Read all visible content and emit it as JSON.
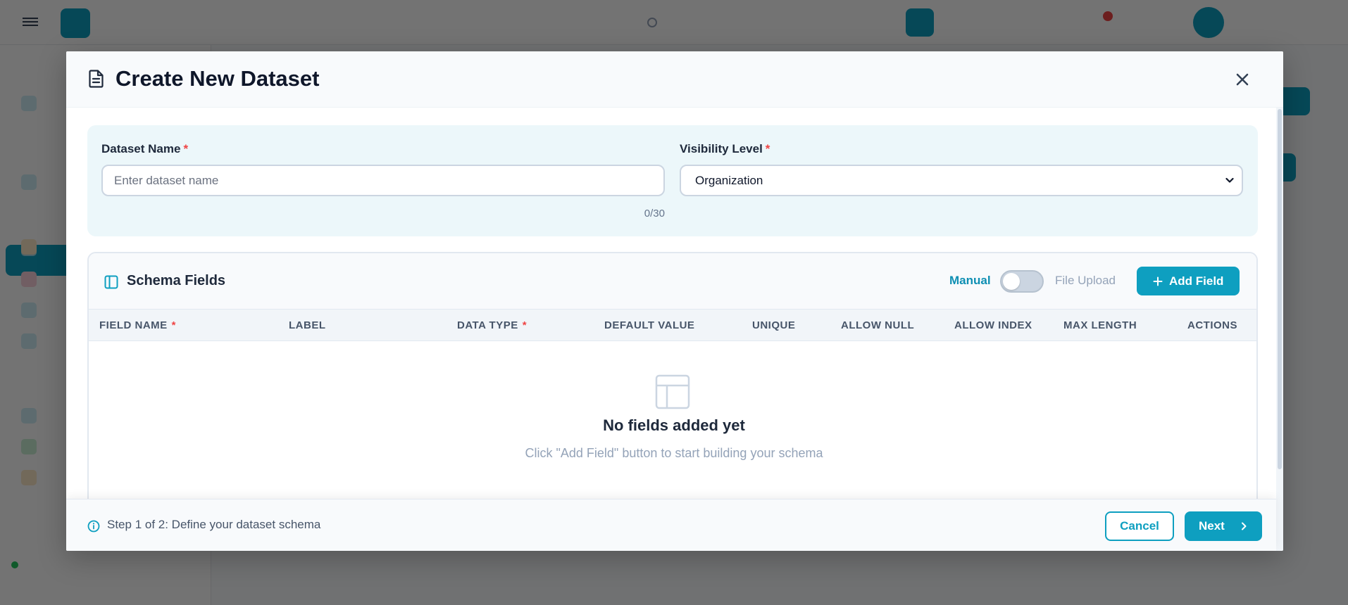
{
  "modal": {
    "title": "Create New Dataset",
    "dataset_name": {
      "label": "Dataset Name",
      "required_mark": "*",
      "value": "",
      "placeholder": "Enter dataset name",
      "counter": "0/30"
    },
    "visibility": {
      "label": "Visibility Level",
      "required_mark": "*",
      "selected": "Organization"
    },
    "schema": {
      "title": "Schema Fields",
      "mode_manual": "Manual",
      "mode_file": "File Upload",
      "add_field_label": "Add Field",
      "columns": [
        "FIELD NAME",
        "LABEL",
        "DATA TYPE",
        "DEFAULT VALUE",
        "UNIQUE",
        "ALLOW NULL",
        "ALLOW INDEX",
        "MAX LENGTH",
        "ACTIONS"
      ],
      "required_mark": "*",
      "empty_title": "No fields added yet",
      "empty_subtitle": "Click \"Add Field\" button to start building your schema"
    },
    "footer": {
      "step_text": "Step 1 of 2: Define your dataset schema",
      "cancel_label": "Cancel",
      "next_label": "Next"
    }
  },
  "colors": {
    "accent": "#0e9fc0",
    "required": "#ef4444",
    "overlay": "rgba(0,0,0,0.55)"
  },
  "icons": {
    "title": "document-icon",
    "close": "close-icon",
    "schema": "sidebar-panel-icon",
    "add": "plus-icon",
    "empty": "table-icon",
    "info": "info-icon",
    "next": "chevron-right-icon"
  }
}
